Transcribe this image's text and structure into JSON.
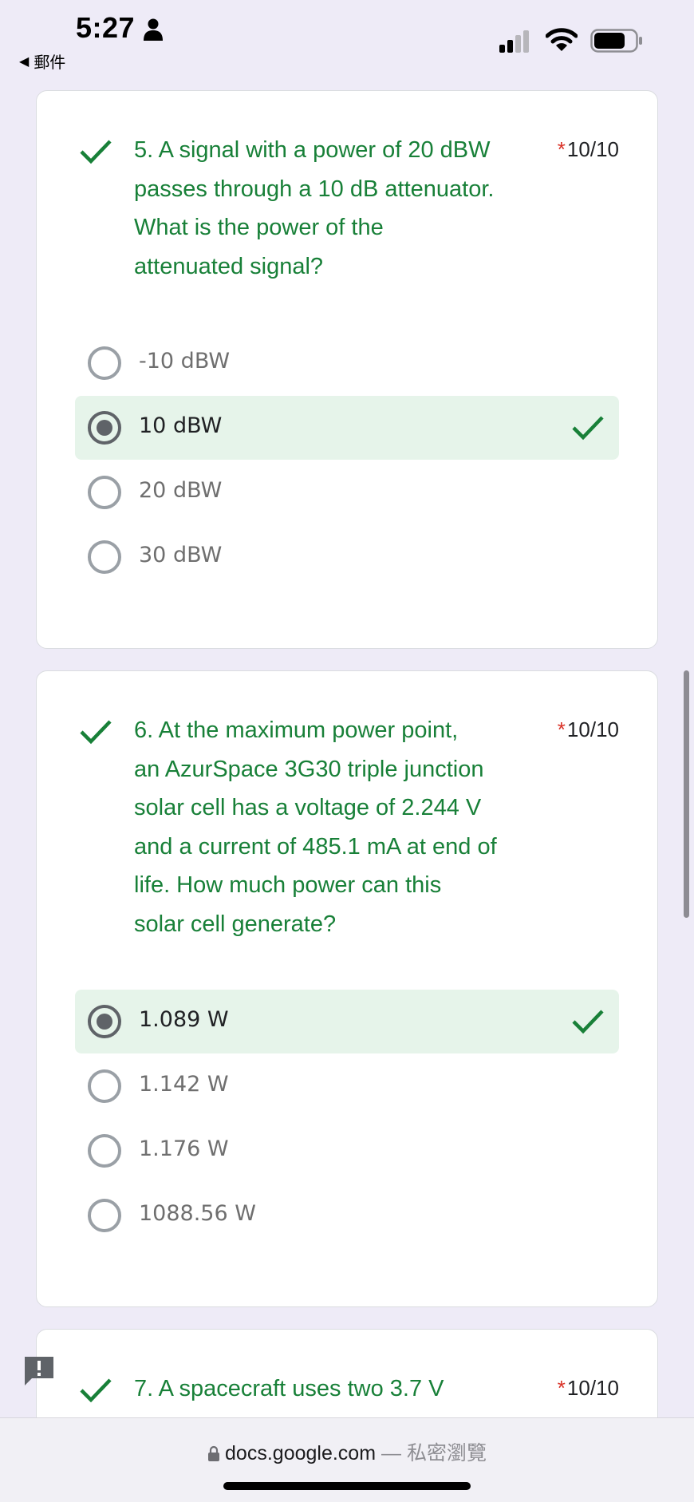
{
  "status_bar": {
    "time": "5:27",
    "back_label": "郵件"
  },
  "questions": [
    {
      "number_text": "5. A signal with a power of 20 dBW passes through a 10 dB attenuator. What is the power of the attenuated signal?",
      "lines": [
        "5. A signal with a power of 20 dBW",
        "passes through a 10 dB attenuator.",
        "What is the power of the",
        "attenuated signal?"
      ],
      "required_mark": "*",
      "points": "10/10",
      "options": [
        {
          "label": "-10 dBW",
          "selected": false,
          "correct": false
        },
        {
          "label": "10 dBW",
          "selected": true,
          "correct": true
        },
        {
          "label": "20 dBW",
          "selected": false,
          "correct": false
        },
        {
          "label": "30 dBW",
          "selected": false,
          "correct": false
        }
      ]
    },
    {
      "lines": [
        "6.  At the maximum power point,",
        "an AzurSpace 3G30 triple junction",
        "solar cell has a voltage of 2.244 V",
        "and a current of 485.1 mA at end of",
        "life. How much power can this",
        "solar cell generate?"
      ],
      "required_mark": "*",
      "points": "10/10",
      "options": [
        {
          "label": "1.089 W",
          "selected": true,
          "correct": true
        },
        {
          "label": "1.142 W",
          "selected": false,
          "correct": false
        },
        {
          "label": "1.176 W",
          "selected": false,
          "correct": false
        },
        {
          "label": "1088.56 W",
          "selected": false,
          "correct": false
        }
      ]
    },
    {
      "lines": [
        "7.  A spacecraft uses two 3.7 V"
      ],
      "required_mark": "*",
      "points": "10/10"
    }
  ],
  "url_bar": {
    "domain": "docs.google.com",
    "separator": " — ",
    "mode": "私密瀏覽"
  },
  "colors": {
    "correct_green": "#188038",
    "selected_bg": "#e6f4ea",
    "required_red": "#d93025",
    "page_bg": "#eeebf7"
  }
}
